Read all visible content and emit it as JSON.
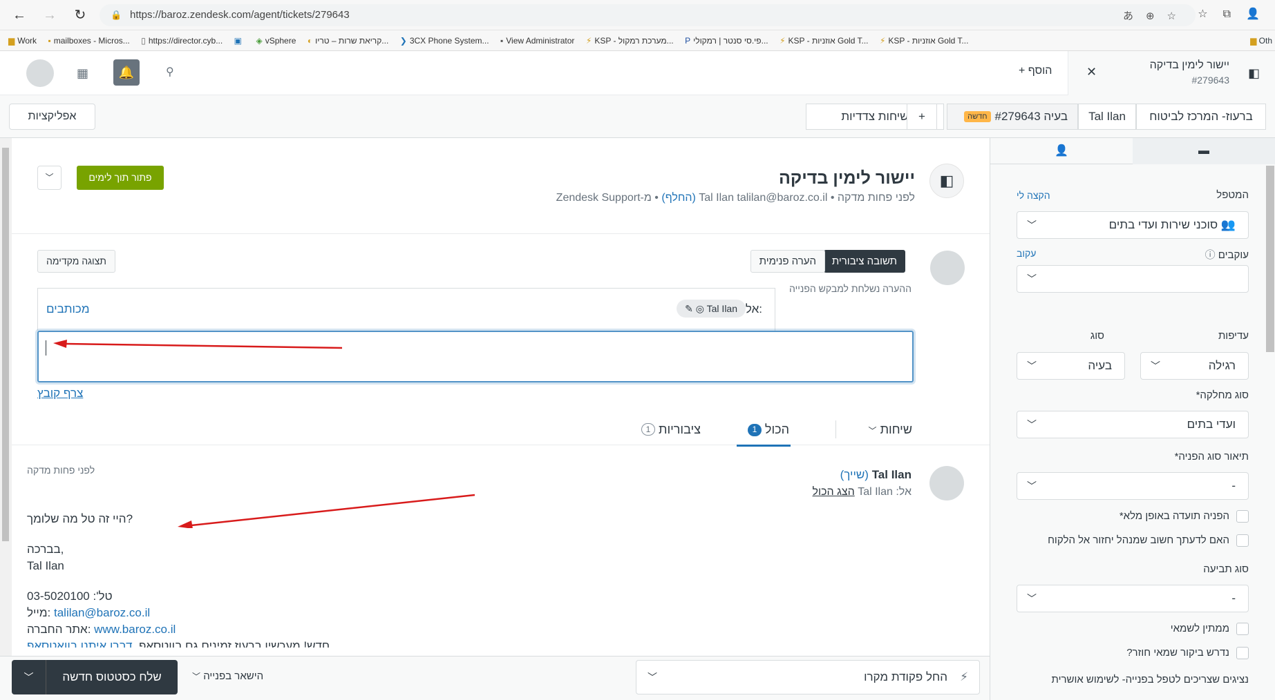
{
  "browser": {
    "url": "https://baroz.zendesk.com/agent/tickets/279643",
    "bookmarks": [
      "Work",
      "mailboxes - Micros...",
      "https://director.cyb...",
      "",
      "vSphere",
      "קריאת שרות – טריו...",
      "3CX Phone System...",
      "View Administrator",
      "KSP - מערכת רמקול...",
      "פי.סי סנטר | רמקולי...",
      "KSP - אוזניות Gold T...",
      "KSP - אוזניות Gold T..."
    ],
    "other_bookmarks": "Oth"
  },
  "header": {
    "add_label": "+ הוסף",
    "tab_title": "יישור לימין בדיקה",
    "tab_number": "#279643"
  },
  "toolbar": {
    "apps": "אפליקציות",
    "side_conversations": "שיחות צדדיות",
    "plus": "+",
    "breadcrumb_org": "ברעוז- המרכז לביטוח",
    "breadcrumb_user": "Tal Ilan",
    "breadcrumb_new": "חדשה",
    "breadcrumb_ticket": "בעיה #279643"
  },
  "ticket": {
    "subject": "יישור לימין בדיקה",
    "meta_prefix": "לפני פחות מדקה • Tal Ilan  talilan@baroz.co.il",
    "meta_change": "(החלף)",
    "meta_suffix": "• מ-Zendesk Support",
    "solve": "פתור תוך לימים"
  },
  "composer": {
    "public_reply": "תשובה ציבורית",
    "internal_note": "הערה פנימית",
    "note": "ההערה נשלחת למבקש הפנייה",
    "preview": "תצוגה מקדימה",
    "to_label": "אל:",
    "recipient": "Tal Ilan",
    "cc": "מכותבים",
    "attach": "צרף קובץ"
  },
  "filters": {
    "conversations": "שיחות",
    "all": "הכול",
    "all_count": "1",
    "public": "ציבוריות",
    "public_count": "1"
  },
  "message": {
    "author": "Tal Ilan",
    "assign": "(שייך)",
    "to_prefix": "אל: Tal Ilan",
    "show_all": "הצג הכול",
    "time": "לפני פחות מדקה",
    "line1": "היי זה טל מה שלומך?",
    "line2": "בברכה,",
    "line3": "Tal Ilan",
    "phone": "טל': 03-5020100",
    "mail_label": "מייל: ",
    "mail": "talilan@baroz.co.il",
    "site_label": "אתר החברה: ",
    "site": "www.baroz.co.il",
    "promo": "חדש! מעכשיו ברעוז זמינים גם בווטסאפ. ",
    "promo_link": "דברו איתנו בוואטסאפ"
  },
  "sidebar": {
    "assignee_label": "המטפל",
    "assign_me": "הקצה לי",
    "assignee_value": "סוכני שירות ועדי בתים",
    "followers_label": "עוקבים",
    "follow": "עקוב",
    "priority_label": "עדיפות",
    "priority_value": "רגילה",
    "type_label": "סוג",
    "type_value": "בעיה",
    "dept_label": "סוג מחלקה*",
    "dept_value": "ועדי בתים",
    "desc_label": "תיאור סוג הפניה*",
    "desc_value": "-",
    "cb1": "הפניה תועדה באופן מלא*",
    "cb2": "האם לדעתך חשוב שמנהל יחזור אל הלקוח",
    "claim_label": "סוג תביעה",
    "claim_value": "-",
    "cb3": "ממתין לשמאי",
    "cb4": "נדרש ביקור שמאי חוזר?",
    "cb5": "נציגים שצריכים לטפל בפנייה- לשימוש אושרית"
  },
  "bottom": {
    "send": "שלח כסטטוס חדשה",
    "stay": "הישאר בפנייה",
    "macro": "החל פקודת מקרו"
  }
}
